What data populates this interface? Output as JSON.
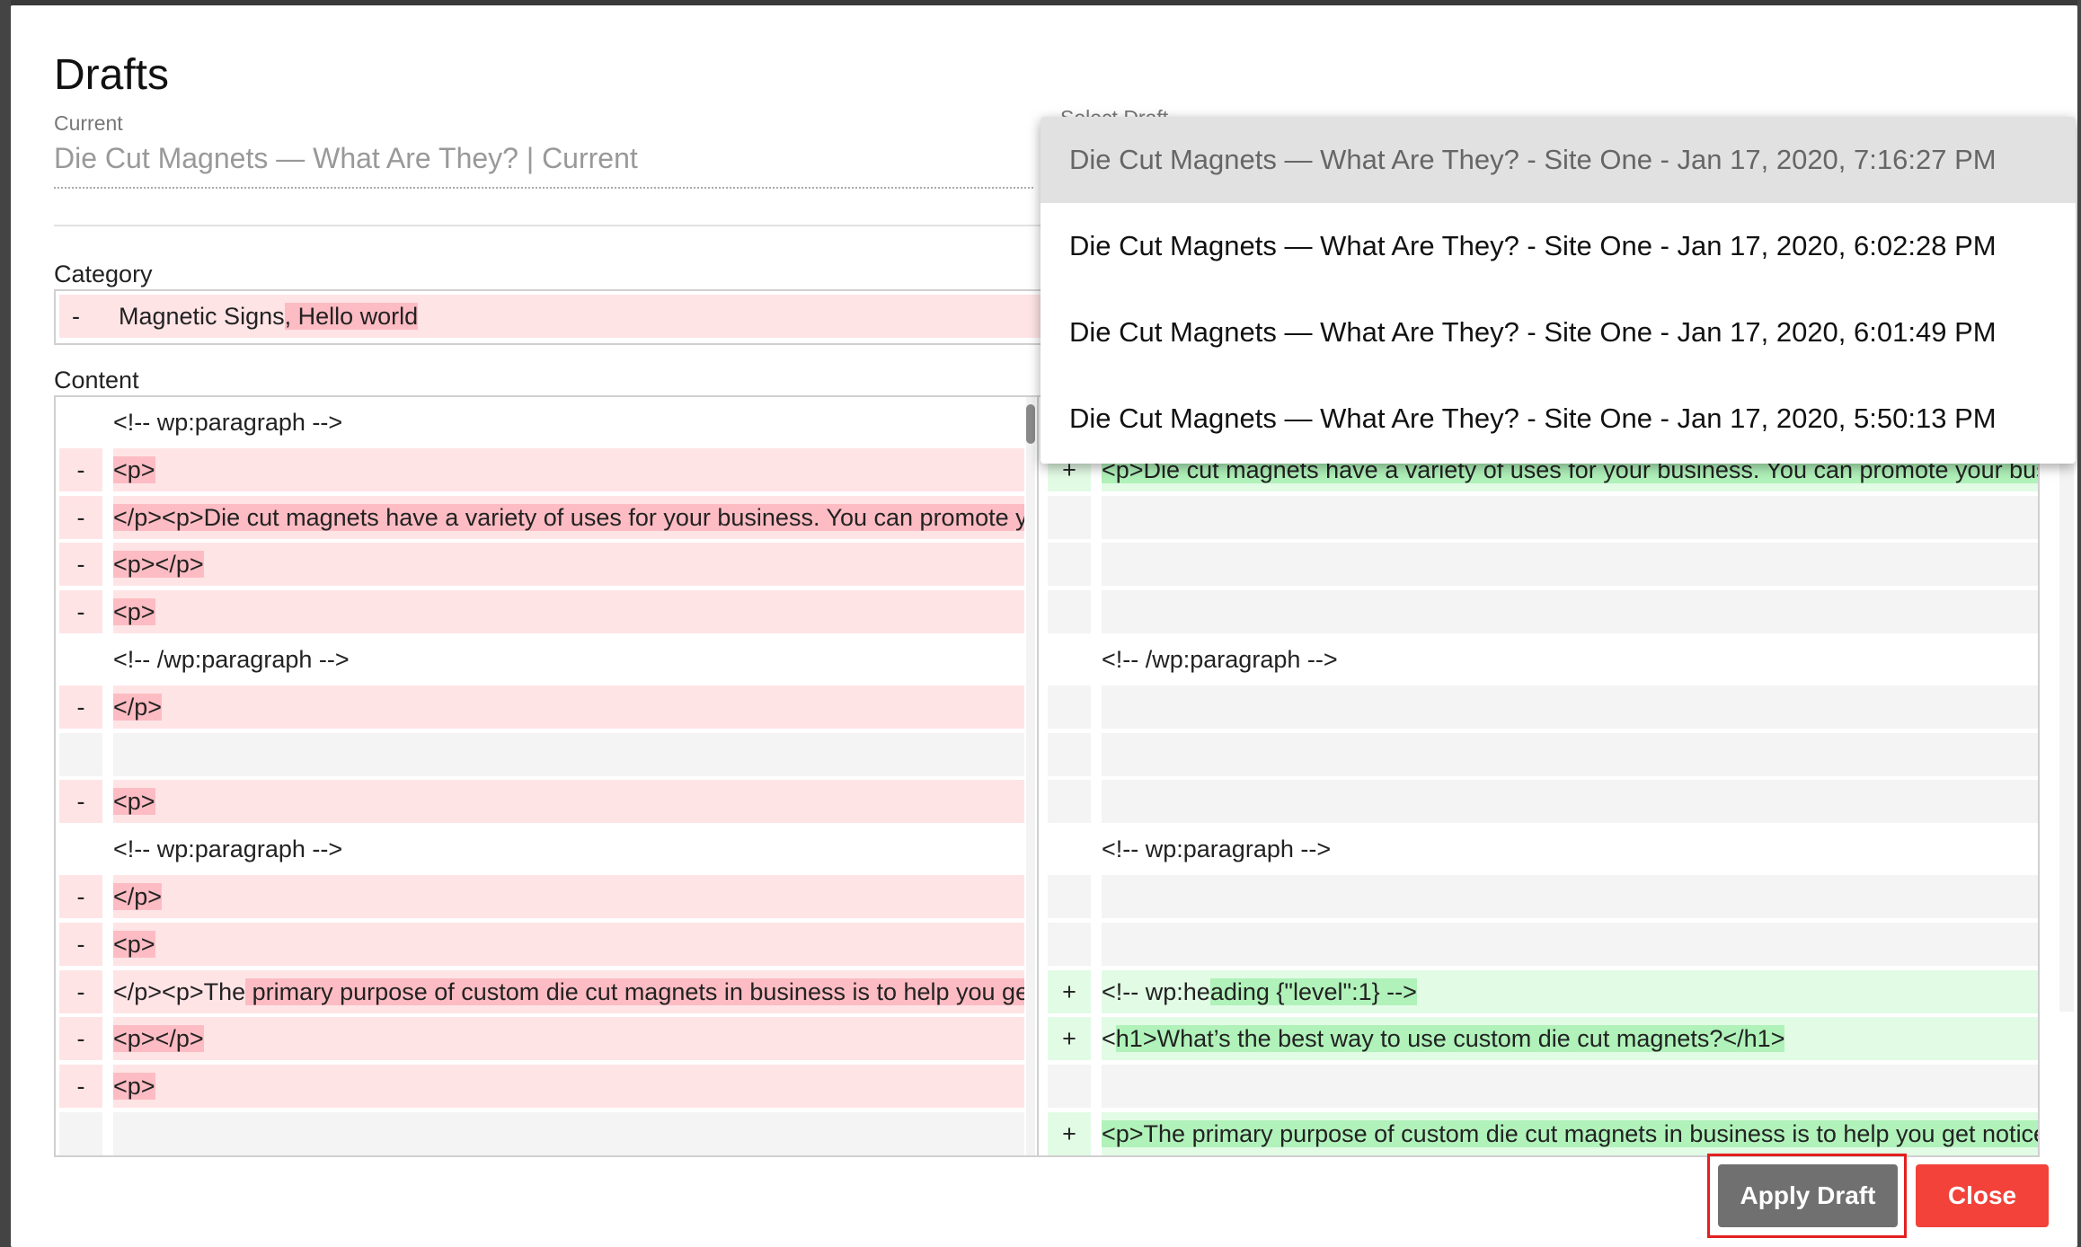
{
  "modal": {
    "title": "Drafts",
    "current_label": "Current",
    "current_value": "Die Cut Magnets — What Are They? | Current",
    "select_label": "Select Draft",
    "category_label": "Category",
    "content_label": "Content",
    "apply_button": "Apply Draft",
    "close_button": "Close"
  },
  "category_row": {
    "sign": "-",
    "text_plain": "Magnetic Signs",
    "text_removed": ", Hello world"
  },
  "dropdown": {
    "items": [
      "Die Cut Magnets — What Are They? - Site One - Jan 17, 2020, 7:16:27 PM",
      "Die Cut Magnets — What Are They? - Site One - Jan 17, 2020, 6:02:28 PM",
      "Die Cut Magnets — What Are They? - Site One - Jan 17, 2020, 6:01:49 PM",
      "Die Cut Magnets — What Are They? - Site One - Jan 17, 2020, 5:50:13 PM"
    ]
  },
  "left_rows": [
    {
      "type": "plain",
      "sign": "",
      "pre": "<!-- wp:paragraph -->",
      "hl": "",
      "post": ""
    },
    {
      "type": "del",
      "sign": "-",
      "pre": "",
      "hl": "<p>",
      "post": ""
    },
    {
      "type": "del",
      "sign": "-",
      "pre": "",
      "hl": "</p><p>Die cut magnets have a variety of uses for your business. You can promote your business",
      "post": ""
    },
    {
      "type": "del",
      "sign": "-",
      "pre": "",
      "hl": "<p></p>",
      "post": ""
    },
    {
      "type": "del",
      "sign": "-",
      "pre": "",
      "hl": "<p>",
      "post": ""
    },
    {
      "type": "plain",
      "sign": "",
      "pre": "<!-- /wp:paragraph -->",
      "hl": "",
      "post": ""
    },
    {
      "type": "del",
      "sign": "-",
      "pre": "",
      "hl": "</p>",
      "post": ""
    },
    {
      "type": "blank",
      "sign": "",
      "pre": "",
      "hl": "",
      "post": ""
    },
    {
      "type": "del",
      "sign": "-",
      "pre": "",
      "hl": "<p>",
      "post": ""
    },
    {
      "type": "plain",
      "sign": "",
      "pre": "<!-- wp:paragraph -->",
      "hl": "",
      "post": ""
    },
    {
      "type": "del",
      "sign": "-",
      "pre": "",
      "hl": "</p>",
      "post": ""
    },
    {
      "type": "del",
      "sign": "-",
      "pre": "",
      "hl": "<p>",
      "post": ""
    },
    {
      "type": "del",
      "sign": "-",
      "pre": "</p><p>The",
      "hl": " primary purpose of custom die cut magnets in business is to help you get noticed",
      "post": ""
    },
    {
      "type": "del",
      "sign": "-",
      "pre": "",
      "hl": "<p></p>",
      "post": ""
    },
    {
      "type": "del",
      "sign": "-",
      "pre": "",
      "hl": "<p>",
      "post": ""
    },
    {
      "type": "blank",
      "sign": "",
      "pre": "",
      "hl": "",
      "post": ""
    }
  ],
  "right_rows": [
    {
      "type": "hidden",
      "sign": "",
      "pre": "",
      "hl": "",
      "post": ""
    },
    {
      "type": "add",
      "sign": "+",
      "pre": "",
      "hl": "<p>Die cut magnets have a variety of uses for your business. You can promote your business",
      "post": ""
    },
    {
      "type": "blank",
      "sign": "",
      "pre": "",
      "hl": "",
      "post": ""
    },
    {
      "type": "blank",
      "sign": "",
      "pre": "",
      "hl": "",
      "post": ""
    },
    {
      "type": "blank",
      "sign": "",
      "pre": "",
      "hl": "",
      "post": ""
    },
    {
      "type": "plain",
      "sign": "",
      "pre": "<!-- /wp:paragraph -->",
      "hl": "",
      "post": ""
    },
    {
      "type": "blank",
      "sign": "",
      "pre": "",
      "hl": "",
      "post": ""
    },
    {
      "type": "blank",
      "sign": "",
      "pre": "",
      "hl": "",
      "post": ""
    },
    {
      "type": "blank",
      "sign": "",
      "pre": "",
      "hl": "",
      "post": ""
    },
    {
      "type": "plain",
      "sign": "",
      "pre": "<!-- wp:paragraph -->",
      "hl": "",
      "post": ""
    },
    {
      "type": "blank",
      "sign": "",
      "pre": "",
      "hl": "",
      "post": ""
    },
    {
      "type": "blank",
      "sign": "",
      "pre": "",
      "hl": "",
      "post": ""
    },
    {
      "type": "add",
      "sign": "+",
      "pre": "<!-- wp:he",
      "hl": "ading {\"level\":1} -->",
      "post": ""
    },
    {
      "type": "add",
      "sign": "+",
      "pre": "<",
      "hl": "h1>What’s the best way to use custom die cut magnets?</h1>",
      "post": ""
    },
    {
      "type": "blank",
      "sign": "",
      "pre": "",
      "hl": "",
      "post": ""
    },
    {
      "type": "add",
      "sign": "+",
      "pre": "",
      "hl": "<p>The primary purpose of custom die cut magnets in business is to help you get noticed",
      "post": ""
    }
  ]
}
